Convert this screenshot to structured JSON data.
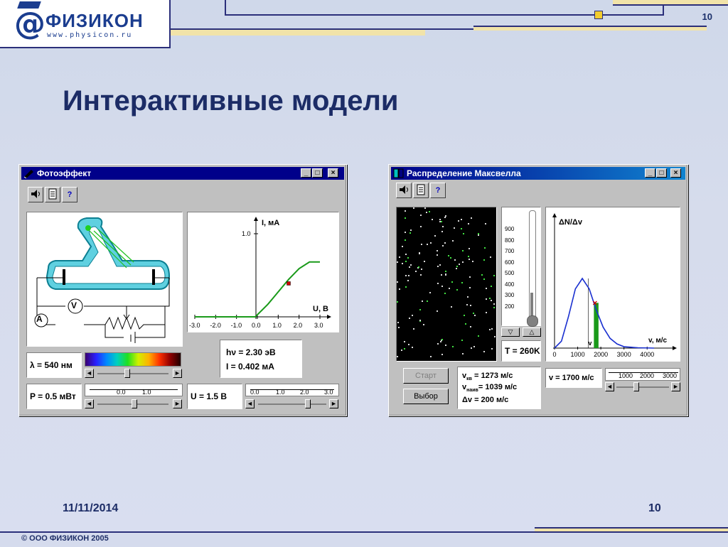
{
  "header": {
    "logo_at": "@",
    "logo_name": "ФИЗИКОН",
    "logo_url": "www.physicon.ru",
    "page_number": "10"
  },
  "slide": {
    "title": "Интерактивные модели",
    "date": "11/11/2014",
    "page_number": "10",
    "copyright": "© ООО ФИЗИКОН 2005"
  },
  "photo": {
    "title": "Фотоэффект",
    "title_buttons": {
      "minimize": "_",
      "maximize": "□",
      "close": "×"
    },
    "toolbar": {
      "sound": "sound-icon",
      "doc": "document-icon",
      "help": "?"
    },
    "circuit": {
      "ammeter": "A",
      "voltmeter": "V"
    },
    "graph": {
      "ylabel": "I, мА",
      "xlabel": "U, В",
      "y_tick": "1.0",
      "x_ticks": [
        "-3.0",
        "-2.0",
        "-1.0",
        "0.0",
        "1.0",
        "2.0",
        "3.0"
      ]
    },
    "chart_data": {
      "type": "line",
      "x": [
        -3.0,
        -0.1,
        0.5,
        1.0,
        1.5,
        2.0,
        2.5,
        3.0
      ],
      "y": [
        0,
        0,
        0.15,
        0.3,
        0.45,
        0.58,
        0.66,
        0.66
      ],
      "marker": {
        "x": 1.5,
        "y": 0.402
      },
      "xlim": [
        -3.0,
        3.0
      ],
      "ylim": [
        0,
        1.0
      ],
      "xlabel": "U, В",
      "ylabel": "I, мА"
    },
    "lambda": "λ = 540 нм",
    "power": "P = 0.5 мВт",
    "voltage": "U = 1.5 В",
    "hv": "hν = 2.30 эВ",
    "current": "I   = 0.402 мА",
    "power_ruler": [
      "0.0",
      "1.0"
    ],
    "voltage_ruler": [
      "0.0",
      "1.0",
      "2.0",
      "3.0"
    ],
    "spectrum_colors": [
      "#3a0070",
      "#2a20ff",
      "#0088ff",
      "#00d0c0",
      "#20e020",
      "#d0f000",
      "#ffb000",
      "#ff3000",
      "#900000",
      "#200000"
    ]
  },
  "maxwell": {
    "title": "Распределение Максвелла",
    "title_buttons": {
      "minimize": "_",
      "maximize": "□",
      "close": "×"
    },
    "toolbar": {
      "sound": "sound-icon",
      "doc": "document-icon",
      "help": "?"
    },
    "thermo_ticks": [
      "900",
      "800",
      "700",
      "600",
      "500",
      "400",
      "300",
      "200"
    ],
    "temperature": "T = 260K",
    "graph": {
      "ylabel": "ΔN/Δv",
      "xlabel": "v, м/с",
      "x_ticks": [
        "0",
        "1000",
        "2000",
        "3000",
        "4000"
      ],
      "marker_label": "v"
    },
    "chart_data": {
      "type": "line",
      "x": [
        0,
        300,
        600,
        900,
        1200,
        1500,
        1800,
        2100,
        2400,
        2700,
        3000,
        3600,
        4300
      ],
      "y": [
        0,
        0.1,
        0.45,
        0.85,
        1.0,
        0.85,
        0.55,
        0.3,
        0.14,
        0.06,
        0.02,
        0.005,
        0
      ],
      "marker_v": 1700,
      "xlim": [
        0,
        4300
      ],
      "xlabel": "v, м/с",
      "ylabel": "ΔN/Δv"
    },
    "start_button": "Старт",
    "select_button": "Выбор",
    "stats": {
      "v_avg": "= 1273 м/с",
      "v_prob": "= 1039 м/с",
      "dv": "Δv  = 200 м/с",
      "sub_avg": "кв",
      "sub_prob": "наив"
    },
    "velocity": "v = 1700 м/с",
    "v_ruler": [
      "1000",
      "2000",
      "3000"
    ]
  }
}
